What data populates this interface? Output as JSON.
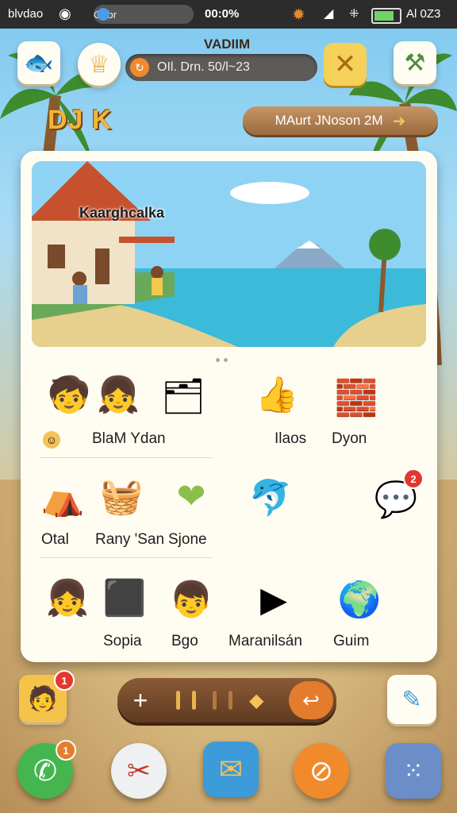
{
  "status_bar": {
    "left_text": "blvdao",
    "pill_text": "Odbr",
    "time": "00:0%",
    "right_text": "Al 0Z3"
  },
  "header": {
    "title": "VADIIM",
    "search_text": "OIl. Drn. 50/l~23",
    "logo": "DJ K",
    "cta_label": "MAurt JNoson 2M"
  },
  "hero": {
    "label": "Kaarghcalka"
  },
  "apps": [
    {
      "label": "BlaM Ydan",
      "icon": "kids-icon"
    },
    {
      "label": "Ilaos",
      "icon": "thumbs-up-icon"
    },
    {
      "label": "Dyon",
      "icon": "blocks-icon"
    },
    {
      "label": "Otal",
      "icon": "campfire-icon"
    },
    {
      "label": "Rany 'San",
      "icon": "basket-icon"
    },
    {
      "label": "Sjone",
      "icon": "heart-sign-icon"
    },
    {
      "label": "Sopia",
      "icon": "girl-icon"
    },
    {
      "label": "Bgo",
      "icon": "cube-icon"
    },
    {
      "label": "Maranilsán",
      "icon": "video-icon"
    },
    {
      "label": "Guim",
      "icon": "globe-icon"
    }
  ],
  "badges": {
    "msg_app": "2",
    "avatar": "1",
    "phone": "1"
  },
  "colors": {
    "accent": "#f08a2b",
    "panel": "#fffdf2",
    "badge": "#e2382f"
  }
}
